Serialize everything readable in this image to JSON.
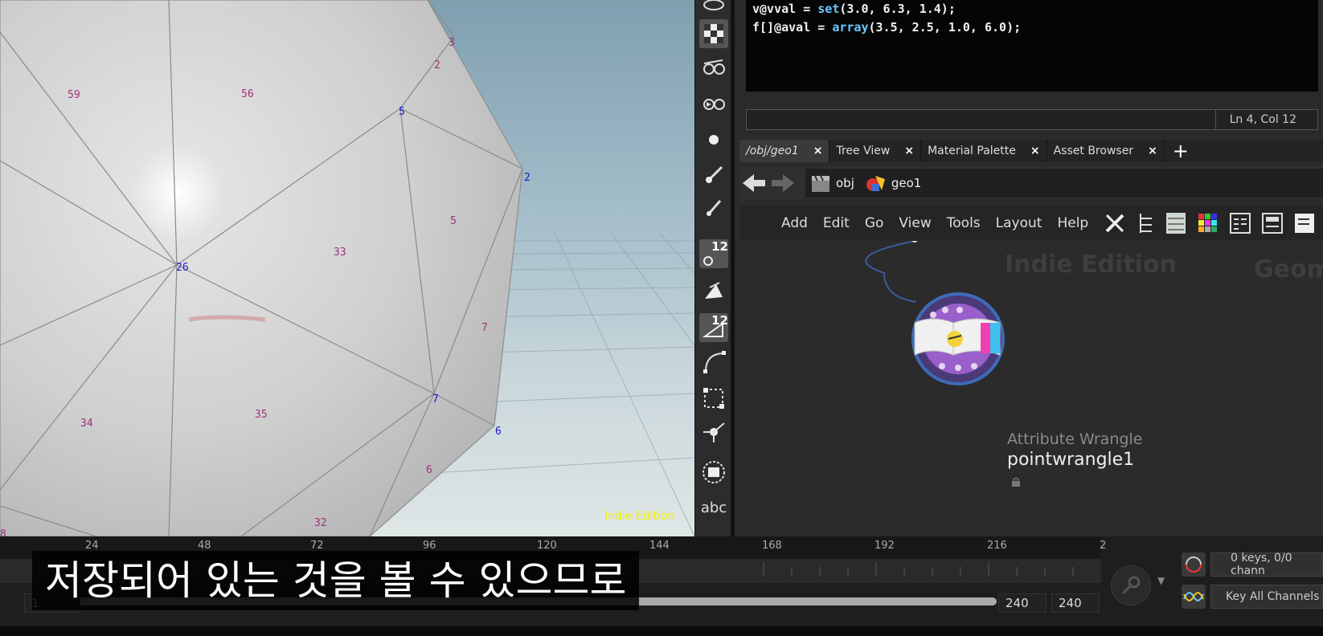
{
  "viewport": {
    "watermark": "Indie Edition",
    "labels": [
      {
        "t": "3",
        "c": "#a0307a"
      },
      {
        "t": "2",
        "c": "#a0307a"
      },
      {
        "t": "59",
        "c": "#a0307a"
      },
      {
        "t": "56",
        "c": "#a0307a"
      },
      {
        "t": "5",
        "c": "#1818d0"
      },
      {
        "t": "2",
        "c": "#1818d0"
      },
      {
        "t": "5",
        "c": "#a0307a"
      },
      {
        "t": "33",
        "c": "#a0307a"
      },
      {
        "t": "26",
        "c": "#1818d0"
      },
      {
        "t": "7",
        "c": "#a0307a"
      },
      {
        "t": "7",
        "c": "#1818d0"
      },
      {
        "t": "34",
        "c": "#a0307a"
      },
      {
        "t": "35",
        "c": "#a0307a"
      },
      {
        "t": "6",
        "c": "#1818d0"
      },
      {
        "t": "6",
        "c": "#a0307a"
      },
      {
        "t": "32",
        "c": "#a0307a"
      },
      {
        "t": "8",
        "c": "#a0307a"
      }
    ]
  },
  "toolshelf": {
    "badges": [
      "12",
      "12"
    ],
    "text_tool": "abc"
  },
  "code": {
    "line1_prefix": "v@vval = ",
    "line1_fn": "set",
    "line1_args": "(3.0, 6.3, 1.4);",
    "line2_prefix": "f[]@aval = ",
    "line2_fn": "array",
    "line2_args": "(3.5, 2.5, 1.0, 6.0);",
    "status": "Ln 4, Col 12"
  },
  "tabs": [
    {
      "label": "/obj/geo1",
      "close": "×"
    },
    {
      "label": "Tree View",
      "close": "×"
    },
    {
      "label": "Material Palette",
      "close": "×"
    },
    {
      "label": "Asset Browser",
      "close": "×"
    }
  ],
  "tab_add": "+",
  "path": {
    "seg1": "obj",
    "seg2": "geo1"
  },
  "net_menu": [
    "Add",
    "Edit",
    "Go",
    "View",
    "Tools",
    "Layout",
    "Help"
  ],
  "network": {
    "watermark": "Indie Edition",
    "context_label": "Geom",
    "node_type": "Attribute Wrangle",
    "node_name": "pointwrangle1"
  },
  "timeline": {
    "ticks": [
      "24",
      "48",
      "72",
      "96",
      "120",
      "144",
      "168",
      "192",
      "216",
      "2"
    ],
    "start_frame": "1",
    "end_frame_1": "240",
    "end_frame_2": "240",
    "keys_status": "0 keys, 0/0 chann",
    "key_all": "Key All Channels"
  },
  "subtitle": "저장되어 있는 것을 볼 수 있으므로"
}
